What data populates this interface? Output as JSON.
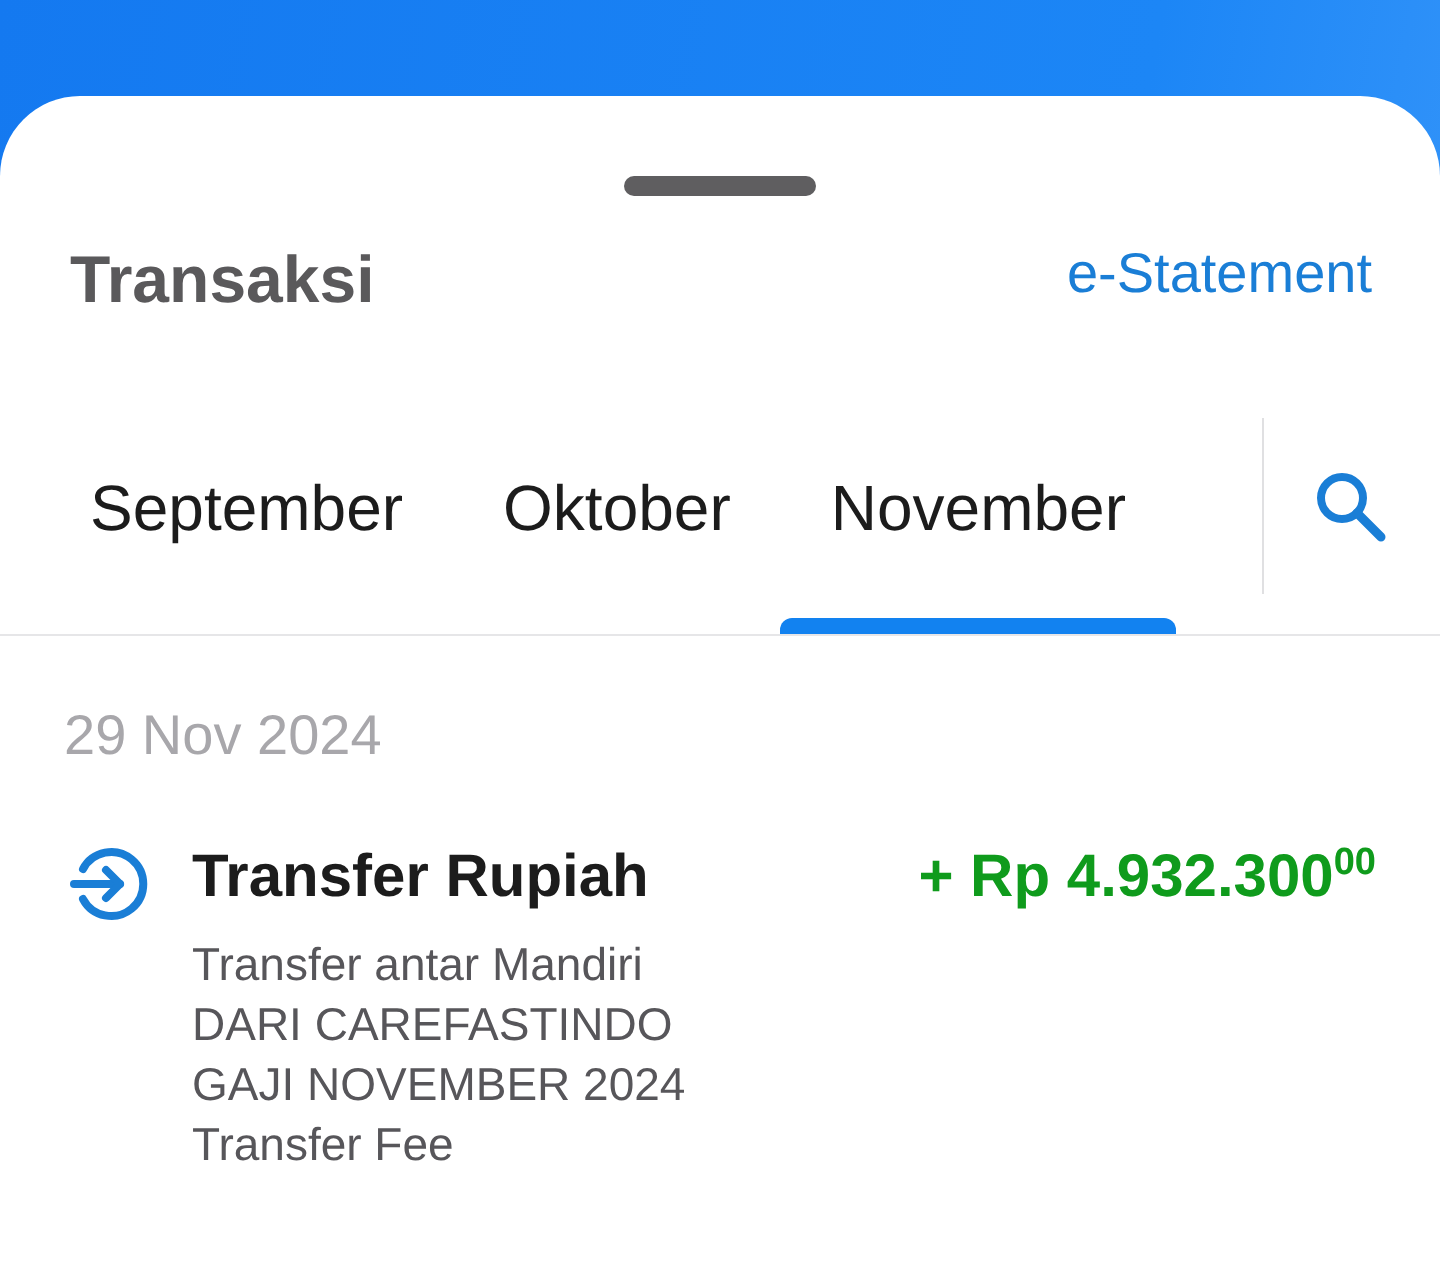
{
  "header": {
    "title": "Transaksi",
    "link": "e-Statement"
  },
  "tabs": [
    {
      "label": "September",
      "selected": false
    },
    {
      "label": "Oktober",
      "selected": false
    },
    {
      "label": "November",
      "selected": true
    }
  ],
  "transactions": [
    {
      "date": "29 Nov 2024",
      "items": [
        {
          "title": "Transfer Rupiah",
          "amount": "+ Rp 4.932.300$^{00}$",
          "kind": "incoming",
          "details": [
            "Transfer antar Mandiri",
            "DARI CAREFASTINDO",
            "GAJI NOVEMBER 2024",
            "Transfer Fee"
          ]
        }
      ]
    }
  ]
}
